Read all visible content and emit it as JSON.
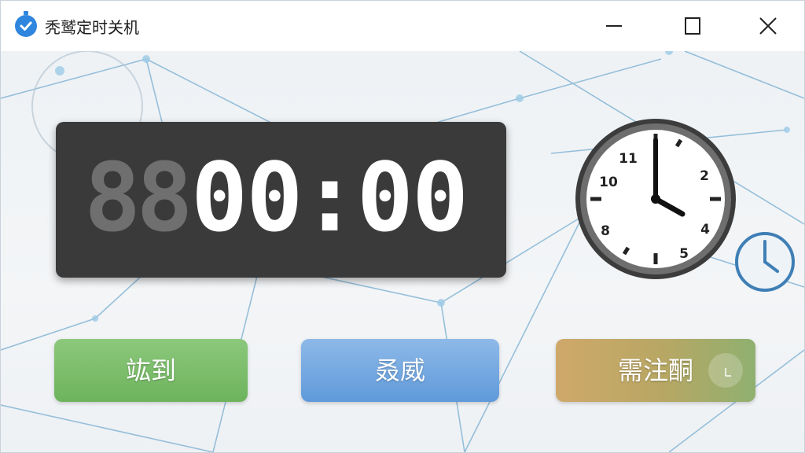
{
  "window": {
    "title": "秃鹫定时关机",
    "controls": {
      "minimize": "minimize-icon",
      "maximize": "maximize-icon",
      "close": "close-icon"
    }
  },
  "timer": {
    "ghost_digits": "88",
    "time": "00:00"
  },
  "clock": {
    "numbers": [
      "11",
      "2",
      "10",
      "4",
      "8",
      "5"
    ],
    "time_shown": "4:00"
  },
  "buttons": {
    "start_label": "竑到",
    "cancel_label": "叒威",
    "settings_label": "需注酮"
  },
  "colors": {
    "start": "#7cbe6b",
    "cancel": "#6fa7e0",
    "settings": "#c2a86a",
    "accent": "#2f86de",
    "display_bg": "#3a3a3a"
  }
}
